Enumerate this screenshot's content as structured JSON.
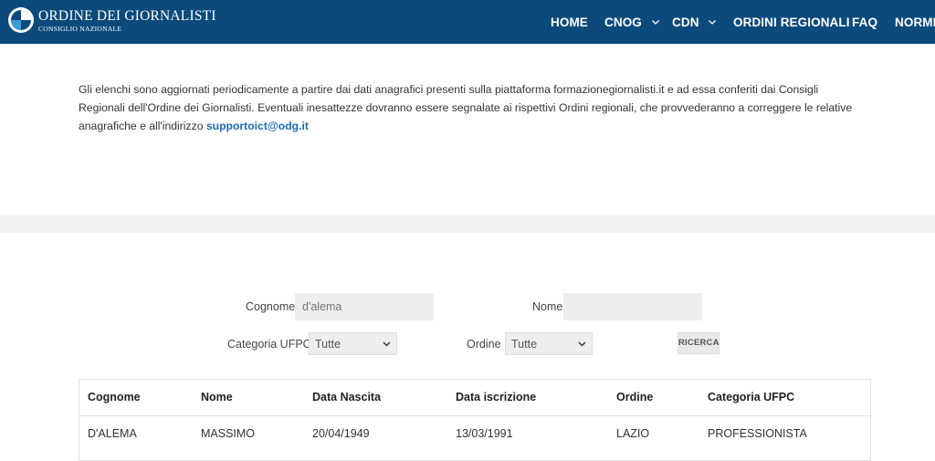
{
  "brand": {
    "title": "ORDINE DEI GIORNALISTI",
    "subtitle": "CONSIGLIO NAZIONALE",
    "color": "#0c4a7c"
  },
  "nav": {
    "home": "HOME",
    "cnog": "CNOG",
    "cdn": "CDN",
    "ordini": "ORDINI REGIONALI",
    "faq": "FAQ",
    "norme": "NORME"
  },
  "intro": {
    "text": "Gli elenchi sono aggiornati periodicamente a partire dai dati anagrafici presenti sulla piattaforma formazionegiornalisti.it e ad essa conferiti dai Consigli Regionali dell'Ordine dei Giornalisti. Eventuali inesattezze dovranno essere segnalate ai rispettivi Ordini regionali, che provvederanno a correggere le relative anagrafiche e all'indirizzo ",
    "email": "supportoict@odg.it"
  },
  "form": {
    "cognome_label": "Cognome",
    "cognome_placeholder": "d'alema",
    "nome_label": "Nome",
    "nome_placeholder": "",
    "categoria_label": "Categoria UFPC",
    "categoria_value": "Tutte",
    "ordine_label": "Ordine",
    "ordine_value": "Tutte",
    "search_button": "RICERCA"
  },
  "table": {
    "headers": {
      "cognome": "Cognome",
      "nome": "Nome",
      "nascita": "Data Nascita",
      "iscrizione": "Data iscrizione",
      "ordine": "Ordine",
      "categoria": "Categoria UFPC"
    },
    "rows": [
      {
        "cognome": "D'ALEMA",
        "nome": "MASSIMO",
        "nascita": "20/04/1949",
        "iscrizione": "13/03/1991",
        "ordine": "LAZIO",
        "categoria": "PROFESSIONISTA"
      }
    ]
  }
}
